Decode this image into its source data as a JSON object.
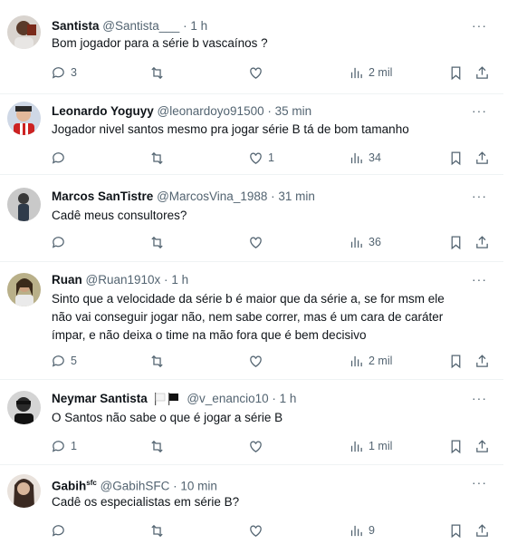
{
  "replies": [
    {
      "name": "Santista",
      "name_suffix": "",
      "handle": "@Santista___",
      "sep": "·",
      "time": "1 h",
      "text": "Bom jogador para a série b vascaínos ?",
      "counts": {
        "replies": "3",
        "retweets": "",
        "likes": "",
        "views": "2 mil"
      }
    },
    {
      "name": "Leonardo Yoguyy",
      "name_suffix": "",
      "handle": "@leonardoyo91500",
      "sep": "·",
      "time": "35 min",
      "text": "Jogador nivel santos mesmo pra jogar série B tá de bom tamanho",
      "counts": {
        "replies": "",
        "retweets": "",
        "likes": "1",
        "views": "34"
      }
    },
    {
      "name": "Marcos SanTistre",
      "name_suffix": "",
      "handle": "@MarcosVina_1988",
      "sep": "·",
      "time": "31 min",
      "text": "Cadê meus consultores?",
      "counts": {
        "replies": "",
        "retweets": "",
        "likes": "",
        "views": "36"
      }
    },
    {
      "name": "Ruan",
      "name_suffix": "",
      "handle": "@Ruan1910x",
      "sep": "·",
      "time": "1 h",
      "text_lines": [
        "Sinto que a velocidade da série b é maior que da série a, se for msm ele",
        "não vai conseguir jogar não, nem sabe correr, mas é um cara de caráter",
        "ímpar, e não deixa o time na mão fora que é bem decisivo"
      ],
      "counts": {
        "replies": "5",
        "retweets": "",
        "likes": "",
        "views": "2 mil"
      }
    },
    {
      "name": "Neymar Santista",
      "name_suffix": "",
      "handle": "@v_enancio10",
      "sep": "·",
      "time": "1 h",
      "text": "O Santos não sabe o que é jogar a série B",
      "counts": {
        "replies": "1",
        "retweets": "",
        "likes": "",
        "views": "1 mil"
      }
    },
    {
      "name": "Gabih",
      "name_suffix": "sfc",
      "handle": "@GabihSFC",
      "sep": "·",
      "time": "10 min",
      "text": "Cadê os especialistas em série B?",
      "counts": {
        "replies": "",
        "retweets": "",
        "likes": "",
        "views": "9"
      }
    }
  ],
  "more_glyph": "···",
  "icons": [
    "reply-icon",
    "retweet-icon",
    "like-icon",
    "views-icon",
    "bookmark-icon",
    "share-icon",
    "more-icon"
  ],
  "colors": {
    "text": "#0f1419",
    "muted": "#536471",
    "divider": "#eff3f4"
  }
}
